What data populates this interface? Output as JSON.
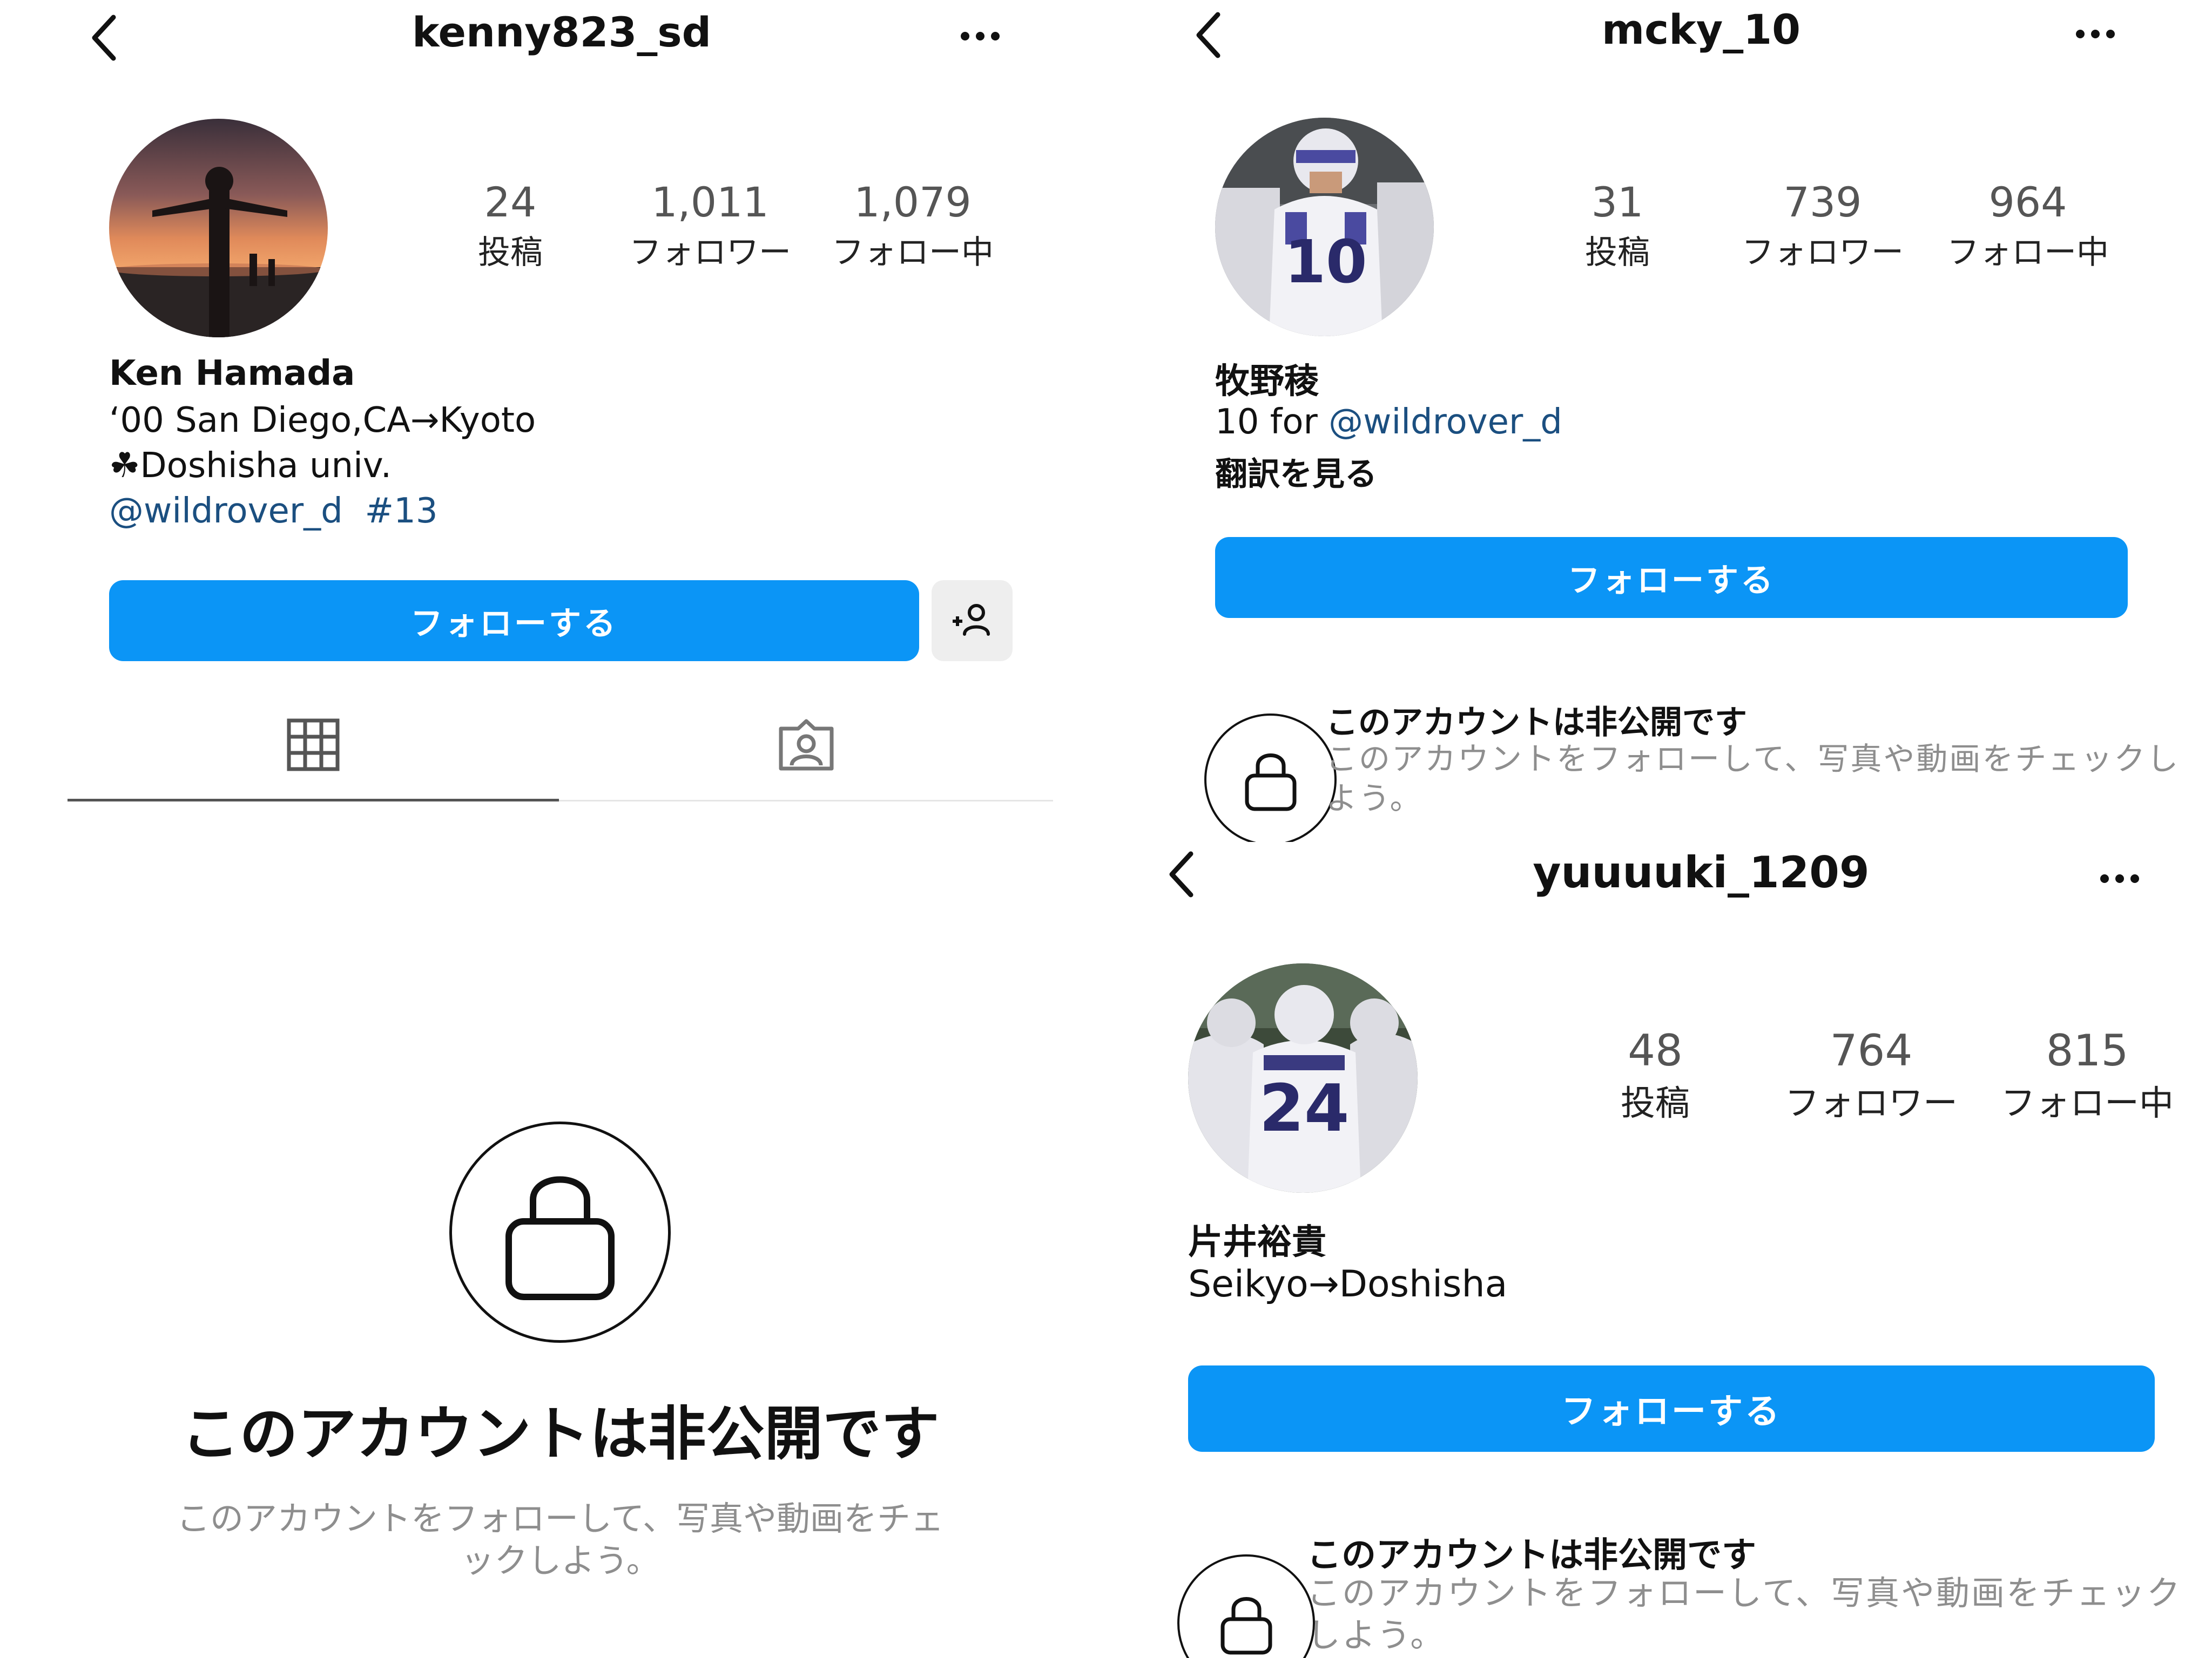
{
  "profiles": [
    {
      "username": "kenny823_sd",
      "stats": [
        {
          "value": "24",
          "label": "投稿"
        },
        {
          "value": "1,011",
          "label": "フォロワー"
        },
        {
          "value": "1,079",
          "label": "フォロー中"
        }
      ],
      "display_name": "Ken Hamada",
      "bio": [
        "‘00 San Diego,CA→Kyoto",
        "☘Doshisha univ."
      ],
      "bio_link_1": "@wildrover_d",
      "bio_link_2": "#13",
      "follow_label": "フォローする",
      "tabs": [
        "grid-icon",
        "tagged-icon"
      ],
      "private_title": "このアカウントは非公開です",
      "private_desc": "このアカウントをフォローして、写真や動画をチェックしよう。"
    },
    {
      "username": "mcky_10",
      "stats": [
        {
          "value": "31",
          "label": "投稿"
        },
        {
          "value": "739",
          "label": "フォロワー"
        },
        {
          "value": "964",
          "label": "フォロー中"
        }
      ],
      "display_name": "牧野稜",
      "bio_prefix": "10 for ",
      "bio_link": "@wildrover_d",
      "translate_label": "翻訳を見る",
      "follow_label": "フォローする",
      "private_title": "このアカウントは非公開です",
      "private_desc": "このアカウントをフォローして、写真や動画をチェックしよう。"
    },
    {
      "username": "yuuuuki_1209",
      "stats": [
        {
          "value": "48",
          "label": "投稿"
        },
        {
          "value": "764",
          "label": "フォロワー"
        },
        {
          "value": "815",
          "label": "フォロー中"
        }
      ],
      "display_name": "片井裕貴",
      "bio": [
        "Seikyo→Doshisha"
      ],
      "follow_label": "フォローする",
      "private_title": "このアカウントは非公開です",
      "private_desc": "このアカウントをフォローして、写真や動画をチェックしよう。"
    }
  ],
  "colors": {
    "follow_blue": "#0b95f6",
    "link": "#1b4f80",
    "muted": "#8e8e8e"
  }
}
